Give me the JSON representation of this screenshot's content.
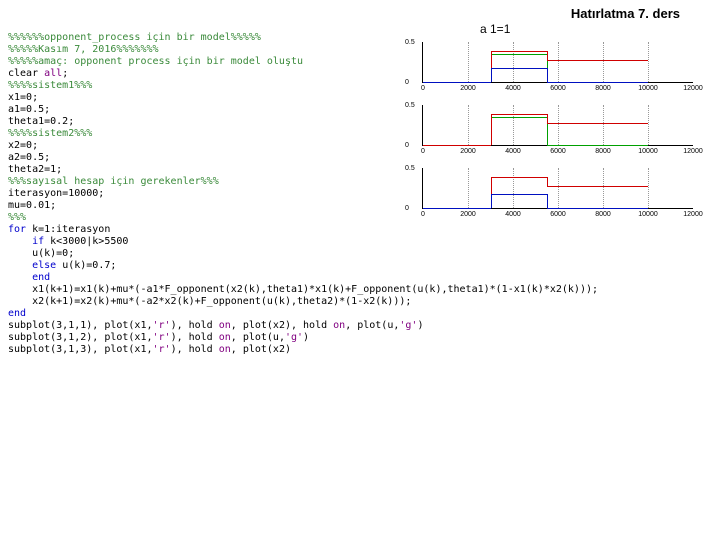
{
  "header": "Hatırlatma 7. ders",
  "chart_title": "a 1=1",
  "code": {
    "l01": "%%%%%%opponent_process için bir model%%%%%",
    "l02": "%%%%%Kasım 7, 2016%%%%%%%",
    "l03": "%%%%%amaç: opponent process için bir model oluştu",
    "l04a": "clear ",
    "l04b": "all",
    "l04c": ";",
    "l05": "%%%%sistem1%%%",
    "l06": "x1=0;",
    "l07": "a1=0.5;",
    "l08": "theta1=0.2;",
    "l09": "%%%%sistem2%%%",
    "l10": "x2=0;",
    "l11": "a2=0.5;",
    "l12": "theta2=1;",
    "l13": "%%%sayısal hesap için gerekenler%%%",
    "l14": "iterasyon=10000;",
    "l15": "mu=0.01;",
    "l16": "%%%",
    "l17a": "for",
    "l17b": " k=1:iterasyon",
    "l18a": "    if",
    "l18b": " k<3000|k>5500",
    "l19": "    u(k)=0;",
    "l20a": "    else",
    "l20b": " u(k)=0.7;",
    "l21": "    end",
    "l22": "    x1(k+1)=x1(k)+mu*(-a1*F_opponent(x2(k),theta1)*x1(k)+F_opponent(u(k),theta1)*(1-x1(k)*x2(k)));",
    "l23": "    x2(k+1)=x2(k)+mu*(-a2*x2(k)+F_opponent(u(k),theta2)*(1-x2(k)));",
    "l24": "end",
    "l25a": "subplot(3,1,1), plot(x1,",
    "l25b": "'r'",
    "l25c": "), hold ",
    "l25d": "on",
    "l25e": ", plot(x2), hold ",
    "l25f": "on",
    "l25g": ", plot(u,",
    "l25h": "'g'",
    "l25i": ")",
    "l26a": "subplot(3,1,2), plot(x1,",
    "l26b": "'r'",
    "l26c": "), hold ",
    "l26d": "on",
    "l26e": ", plot(u,",
    "l26f": "'g'",
    "l26g": ")",
    "l27a": "subplot(3,1,3), plot(x1,",
    "l27b": "'r'",
    "l27c": "), hold ",
    "l27d": "on",
    "l27e": ", plot(x2)"
  },
  "chart_data": [
    {
      "type": "line",
      "title": "",
      "xlabel": "",
      "ylabel": "",
      "xlim": [
        0,
        12000
      ],
      "ylim": [
        0,
        1
      ],
      "xticks": [
        0,
        2000,
        4000,
        6000,
        8000,
        10000,
        12000
      ],
      "yticks": [
        0,
        0.5
      ],
      "series": [
        {
          "name": "u",
          "color": "#00a000",
          "segments": [
            {
              "x0": 0,
              "x1": 3000,
              "y": 0
            },
            {
              "x0": 3000,
              "x1": 5500,
              "y": 0.7
            },
            {
              "x0": 5500,
              "x1": 10000,
              "y": 0
            }
          ]
        },
        {
          "name": "x1",
          "color": "#d00000",
          "segments": [
            {
              "x0": 0,
              "x1": 3000,
              "y": 0
            },
            {
              "x0": 3000,
              "x1": 5500,
              "y": 0.78
            },
            {
              "x0": 5500,
              "x1": 10000,
              "y": 0.55
            }
          ]
        },
        {
          "name": "x2",
          "color": "#0010c0",
          "segments": [
            {
              "x0": 0,
              "x1": 3000,
              "y": 0
            },
            {
              "x0": 3000,
              "x1": 5500,
              "y": 0.35
            },
            {
              "x0": 5500,
              "x1": 10000,
              "y": 0
            }
          ]
        }
      ]
    },
    {
      "type": "line",
      "xlim": [
        0,
        12000
      ],
      "ylim": [
        0,
        1
      ],
      "xticks": [
        0,
        2000,
        4000,
        6000,
        8000,
        10000,
        12000
      ],
      "yticks": [
        0,
        0.5
      ],
      "series": [
        {
          "name": "u",
          "color": "#00a000",
          "segments": [
            {
              "x0": 0,
              "x1": 3000,
              "y": 0
            },
            {
              "x0": 3000,
              "x1": 5500,
              "y": 0.7
            },
            {
              "x0": 5500,
              "x1": 10000,
              "y": 0
            }
          ]
        },
        {
          "name": "x1",
          "color": "#d00000",
          "segments": [
            {
              "x0": 0,
              "x1": 3000,
              "y": 0
            },
            {
              "x0": 3000,
              "x1": 5500,
              "y": 0.78
            },
            {
              "x0": 5500,
              "x1": 10000,
              "y": 0.55
            }
          ]
        }
      ]
    },
    {
      "type": "line",
      "xlim": [
        0,
        12000
      ],
      "ylim": [
        0,
        1
      ],
      "xticks": [
        0,
        2000,
        4000,
        6000,
        8000,
        10000,
        12000
      ],
      "yticks": [
        0,
        0.5
      ],
      "series": [
        {
          "name": "x1",
          "color": "#d00000",
          "segments": [
            {
              "x0": 0,
              "x1": 3000,
              "y": 0
            },
            {
              "x0": 3000,
              "x1": 5500,
              "y": 0.78
            },
            {
              "x0": 5500,
              "x1": 10000,
              "y": 0.55
            }
          ]
        },
        {
          "name": "x2",
          "color": "#0010c0",
          "segments": [
            {
              "x0": 0,
              "x1": 3000,
              "y": 0
            },
            {
              "x0": 3000,
              "x1": 5500,
              "y": 0.35
            },
            {
              "x0": 5500,
              "x1": 10000,
              "y": 0
            }
          ]
        }
      ]
    }
  ],
  "axis_labels": {
    "y0": "0",
    "y05": "0.5",
    "x0": "0",
    "x2": "2000",
    "x4": "4000",
    "x6": "6000",
    "x8": "8000",
    "x10": "10000",
    "x12": "12000"
  }
}
